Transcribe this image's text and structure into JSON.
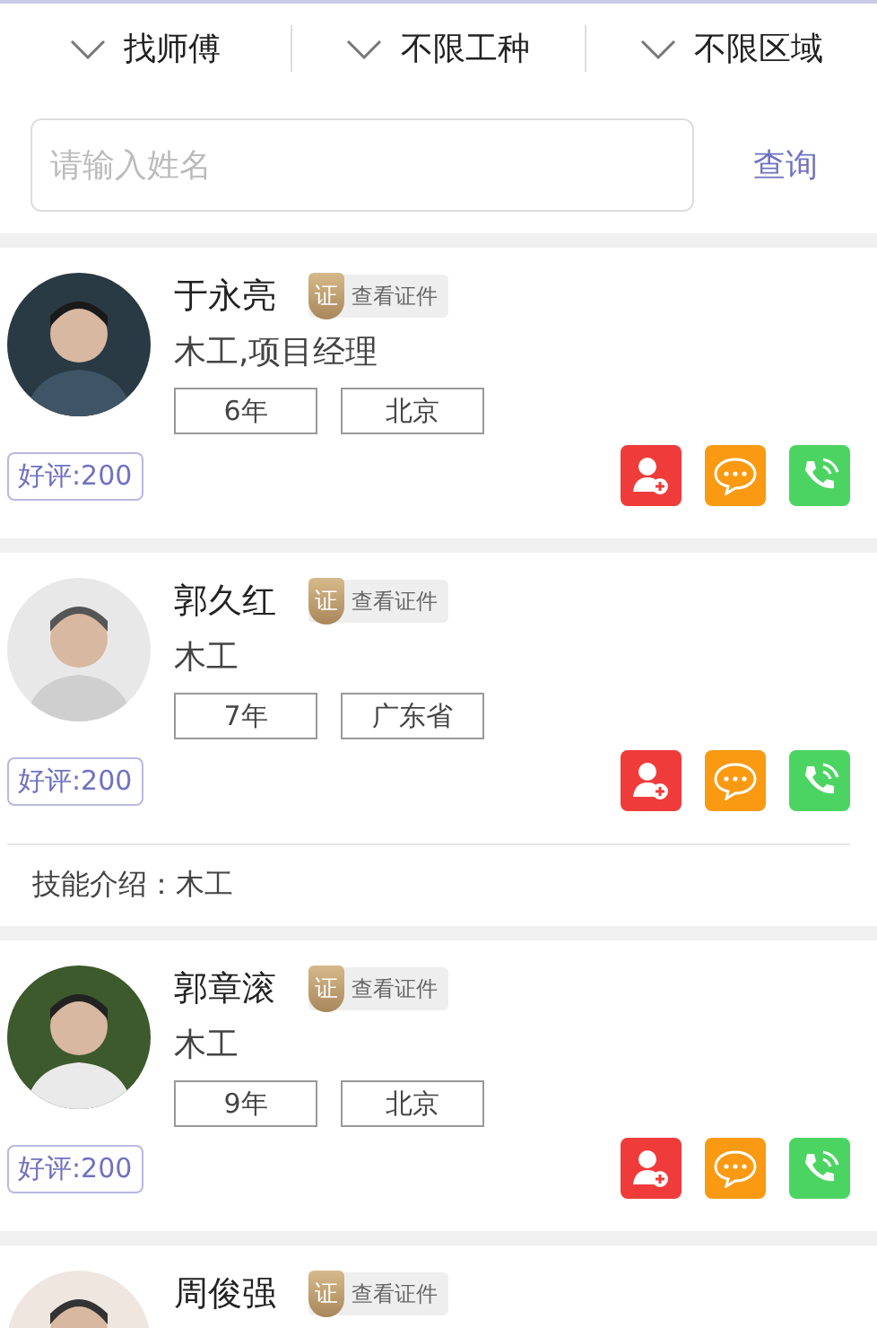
{
  "filters": [
    {
      "label": "找师傅"
    },
    {
      "label": "不限工种"
    },
    {
      "label": "不限区域"
    }
  ],
  "search": {
    "placeholder": "请输入姓名",
    "button": "查询"
  },
  "workers": [
    {
      "name": "于永亮",
      "cert": {
        "mark": "证",
        "label": "查看证件"
      },
      "trade": "木工,项目经理",
      "years": "6年",
      "region": "北京",
      "rating": "好评:200"
    },
    {
      "name": "郭久红",
      "cert": {
        "mark": "证",
        "label": "查看证件"
      },
      "trade": "木工",
      "years": "7年",
      "region": "广东省",
      "rating": "好评:200",
      "skills": "技能介绍：木工"
    },
    {
      "name": "郭章滚",
      "cert": {
        "mark": "证",
        "label": "查看证件"
      },
      "trade": "木工",
      "years": "9年",
      "region": "北京",
      "rating": "好评:200"
    },
    {
      "name": "周俊强",
      "cert": {
        "mark": "证",
        "label": "查看证件"
      }
    }
  ]
}
